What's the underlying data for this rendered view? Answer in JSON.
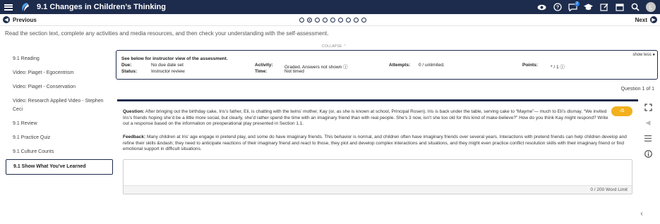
{
  "header": {
    "title": "9.1 Changes in Children’s Thinking",
    "icons": [
      "menu-icon",
      "logo-icon",
      "eye-icon",
      "help-icon",
      "chat-icon",
      "graduation-cap-icon",
      "edit-icon",
      "calendar-icon",
      "search-icon",
      "avatar"
    ],
    "chat_badge": "2",
    "avatar_initial": "L",
    "bar_color": "#1d2b4c"
  },
  "nav": {
    "previous": "Previous",
    "next": "Next",
    "page_dots": 9,
    "active_dot": 2
  },
  "instructions": "Read the section text, complete any activities and media resources, and then check your understanding with the self-assessment.",
  "sidebar": {
    "items": [
      {
        "label": "9.1 Reading"
      },
      {
        "label": "Video: Piaget - Egocentrism"
      },
      {
        "label": "Video: Piaget - Conservation"
      },
      {
        "label": "Video: Research Applied Video - Stephen Ceci"
      },
      {
        "label": "9.1 Review"
      },
      {
        "label": "9.1 Practice Quiz"
      },
      {
        "label": "9.1 Culture Counts"
      },
      {
        "label": "9.1 Show What You've Learned",
        "active": true
      }
    ]
  },
  "collapse_label": "COLLAPSE",
  "assessment": {
    "heading": "See below for instructor view of the assessment.",
    "show_less": "show less",
    "due_label": "Due:",
    "due_value": "No due date set",
    "status_label": "Status:",
    "status_value": "Instructor review",
    "activity_label": "Activity:",
    "activity_value": "Graded. Answers not shown",
    "time_label": "Time:",
    "time_value": "Not timed",
    "attempts_label": "Attempts:",
    "attempts_value": "0 / unlimited.",
    "points_label": "Points:",
    "points_value": "* / 1"
  },
  "question_count": "Question 1 of 1",
  "question": {
    "label": "Question:",
    "text": "After bringing out the birthday cake, Iris’s father, Eli, is chatting with the twins’ mother, Kay (or, as she is known at school, Principal Rosen). Iris is back under the table, serving cake to “Mayme”— much to Eli’s dismay. “We invited Iris’s friends hoping she’d be a little more social, but clearly, she’d rather spend the time with an imaginary friend than with real people. She’s 3 now, isn’t she too old for this kind of make-believe?” How do you think Kay might respond? Write out a response based on the information on preoperational play presented in Section 1.1.",
    "points_pill": "-/1",
    "feedback_label": "Feedback:",
    "feedback_text": "Many children at Iris’ age engage in pretend play, and some do have imaginary friends. This behavior is normal, and children often have imaginary friends over several years. Interactions with pretend friends can help children develop and refine their skills &ndash; they need to anticipate reactions of their imaginary friend and react to those, they plot and develop complex interactions and situations, and they might even practice conflict resolution skills with their imaginary friend or find emotional support in difficult situations.",
    "answer_value": "",
    "word_count": "0 / 200 Word Limit"
  },
  "rail_icons": [
    "expand-icon",
    "collapse-left-icon",
    "list-icon",
    "info-icon",
    "chevron-left-icon"
  ],
  "colors": {
    "accent": "#1d2b4c",
    "pill": "#f2b01e"
  }
}
